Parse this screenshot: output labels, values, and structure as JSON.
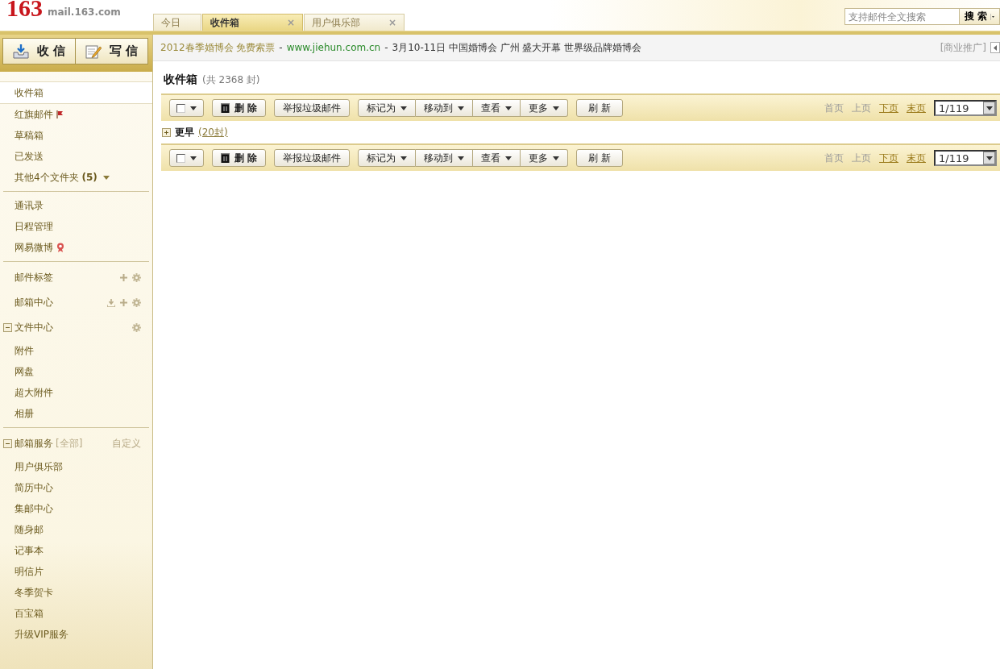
{
  "logo": {
    "mark": "163",
    "domain": "mail.163.com"
  },
  "tabs": [
    {
      "label": "今日",
      "selected": false
    },
    {
      "label": "收件箱",
      "selected": true,
      "close": "×"
    },
    {
      "label": "用户俱乐部",
      "selected": false,
      "close": "×"
    }
  ],
  "search": {
    "placeholder": "支持邮件全文搜索",
    "button": "搜 索"
  },
  "compose_buttons": [
    {
      "kind": "receive",
      "label": "收 信"
    },
    {
      "kind": "write",
      "label": "写 信"
    }
  ],
  "ad": {
    "title": "2012春季婚博会 免费索票",
    "separator_1": "-",
    "url": "www.jiehun.com.cn",
    "separator_2": "-",
    "text": "3月10-11日 中国婚博会 广州 盛大开幕 世界级品牌婚博会",
    "label": "[商业推广]"
  },
  "sidebar": {
    "sections": [
      {
        "items": [
          {
            "label": "收件箱",
            "kind": "plain",
            "selected": true
          },
          {
            "label": "红旗邮件",
            "kind": "flag",
            "selected": false
          },
          {
            "label": "草稿箱",
            "kind": "plain",
            "selected": false
          },
          {
            "label": "已发送",
            "kind": "plain",
            "selected": false
          },
          {
            "label": "其他4个文件夹 **(5)**",
            "kind": "more",
            "selected": false
          }
        ]
      },
      {
        "items": [
          {
            "label": "通讯录",
            "kind": "plain",
            "selected": false
          },
          {
            "label": "日程管理",
            "kind": "plain",
            "selected": false
          },
          {
            "label": "网易微博",
            "kind": "badge",
            "selected": false
          }
        ]
      },
      {
        "items": [
          {
            "label": "邮件标签",
            "kind": "tags",
            "selected": false
          },
          {
            "label": "邮箱中心",
            "kind": "center",
            "selected": false
          },
          {
            "label": "文件中心",
            "kind": "group",
            "expanded": true,
            "selected": false,
            "children": [
              {
                "label": "附件",
                "selected": false
              },
              {
                "label": "网盘",
                "selected": false
              },
              {
                "label": "超大附件",
                "selected": false
              },
              {
                "label": "相册",
                "selected": false
              }
            ]
          }
        ]
      },
      {
        "items": [
          {
            "label": "邮箱服务",
            "kind": "services",
            "all": "[全部]",
            "customize": "自定义",
            "expanded": true,
            "selected": false,
            "children": [
              {
                "label": "用户俱乐部",
                "selected": false
              },
              {
                "label": "简历中心",
                "selected": false
              },
              {
                "label": "集邮中心",
                "selected": false
              },
              {
                "label": "随身邮",
                "selected": false
              },
              {
                "label": "记事本",
                "selected": false
              },
              {
                "label": "明信片",
                "selected": false
              },
              {
                "label": "冬季贺卡",
                "selected": false
              },
              {
                "label": "百宝箱",
                "selected": false
              },
              {
                "label": "升级VIP服务",
                "selected": false
              }
            ]
          }
        ]
      }
    ]
  },
  "folder": {
    "title": "收件箱",
    "count": "(共 2368 封)"
  },
  "toolbars": [
    {
      "checked": false,
      "delete": "删 除",
      "report": "举报垃圾邮件",
      "menus": [
        "标记为",
        "移动到",
        "查看",
        "更多"
      ],
      "refresh": "刷 新",
      "pager": [
        {
          "label": "首页",
          "disabled": true
        },
        {
          "label": "上页",
          "disabled": true
        },
        {
          "label": "下页",
          "disabled": false
        },
        {
          "label": "末页",
          "disabled": false
        }
      ],
      "page": "1/119"
    },
    {
      "checked": false,
      "delete": "删 除",
      "report": "举报垃圾邮件",
      "menus": [
        "标记为",
        "移动到",
        "查看",
        "更多"
      ],
      "refresh": "刷 新",
      "pager": [
        {
          "label": "首页",
          "disabled": true
        },
        {
          "label": "上页",
          "disabled": true
        },
        {
          "label": "下页",
          "disabled": false
        },
        {
          "label": "末页",
          "disabled": false
        }
      ],
      "page": "1/119"
    }
  ],
  "mail_group": {
    "label": "更早",
    "count": "(20封)",
    "expanded": false
  }
}
